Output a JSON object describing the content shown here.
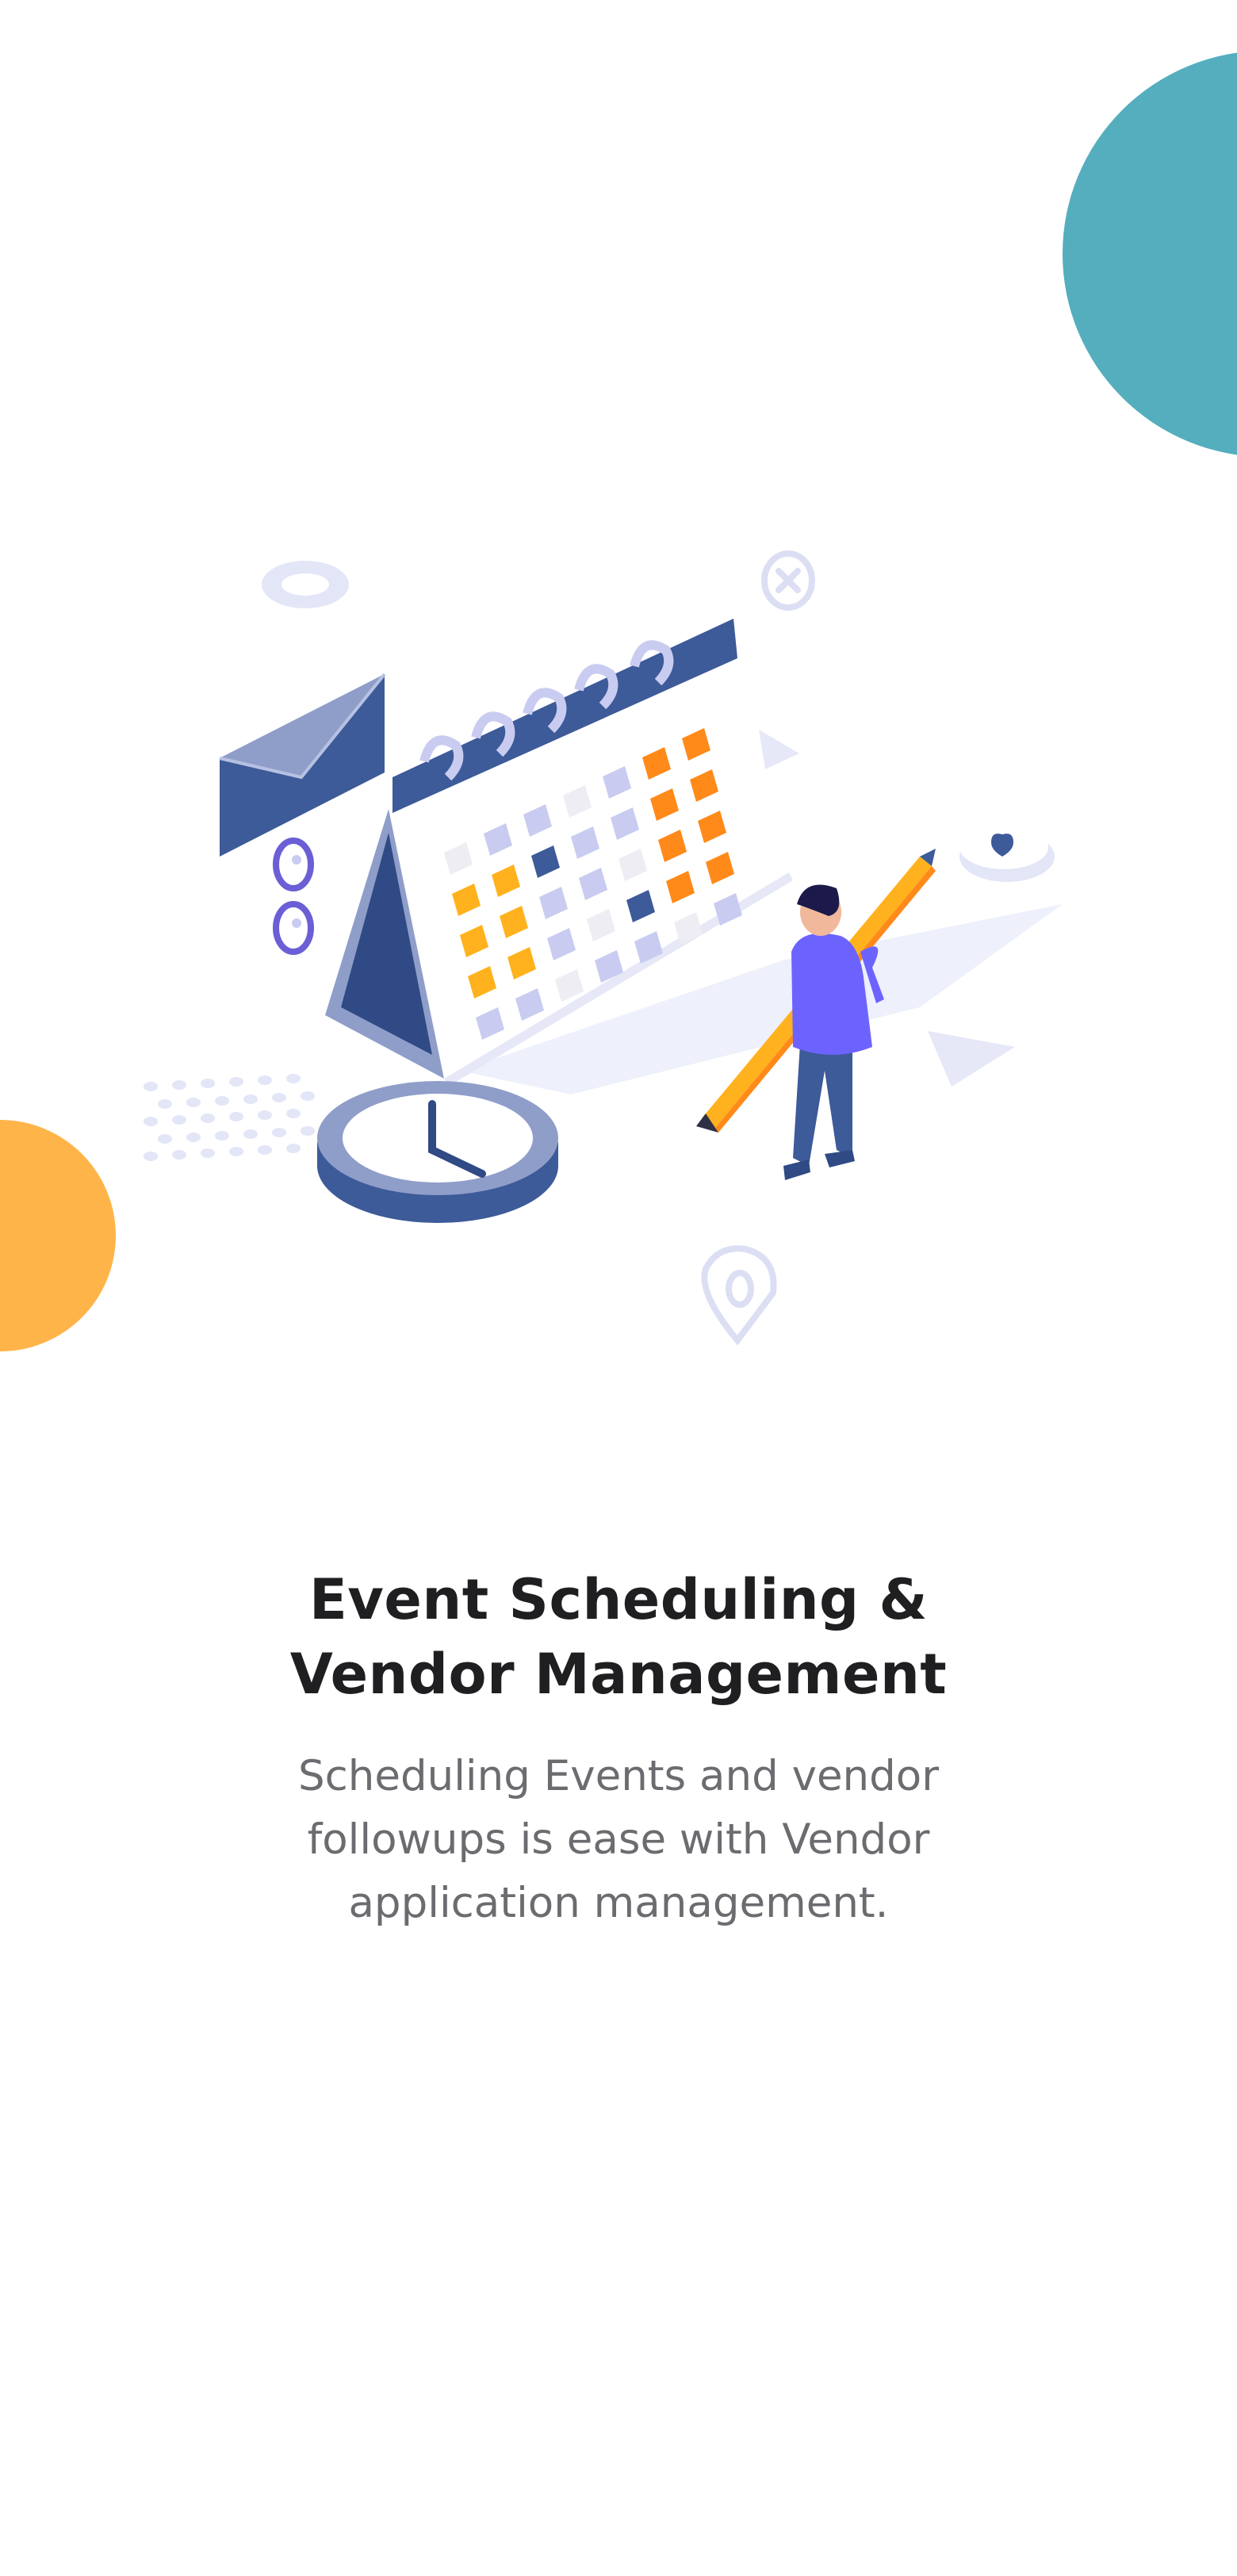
{
  "onboarding": {
    "title_line1": "Event Scheduling &",
    "title_line2": "Vendor Management",
    "description_line1": "Scheduling Events and vendor",
    "description_line2": "followups is ease with Vendor",
    "description_line3": "application management."
  },
  "colors": {
    "teal_accent": "#54aebd",
    "orange_accent": "#ffb44a",
    "calendar_blue": "#3d5a99",
    "calendar_orange": "#ff8a1a",
    "calendar_yellow": "#ffb21d",
    "calendar_lavender": "#c9ccf0",
    "person_purple": "#6c63ff"
  },
  "illustration": {
    "icons": [
      "envelope-icon",
      "calendar-icon",
      "clock-icon",
      "pencil-icon",
      "person-figure",
      "heart-bubble-icon",
      "location-pin-icon",
      "user-badge-icon",
      "close-circle-icon"
    ]
  }
}
